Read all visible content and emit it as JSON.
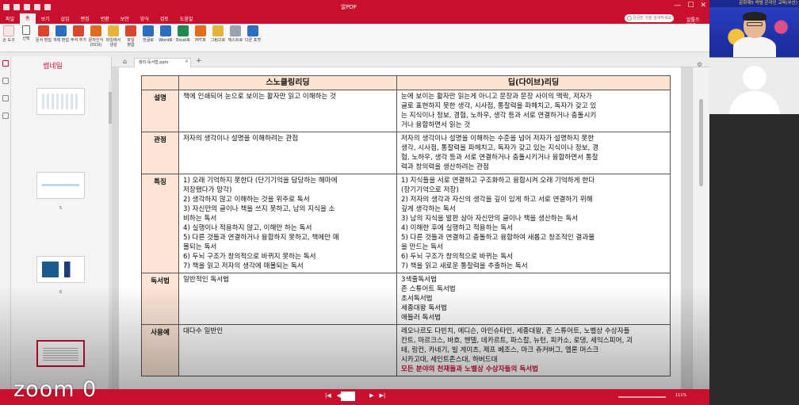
{
  "window": {
    "app_title": "알PDF",
    "controls": [
      "—",
      "☐",
      "✕"
    ]
  },
  "menu": {
    "items": [
      "파일",
      "홈",
      "보기",
      "삽입",
      "편집",
      "변환",
      "보안",
      "양식",
      "검토",
      "도움말"
    ],
    "active_index": 1,
    "search_placeholder": "궁금한 것을 검색하세요!",
    "right_title": "알툴즈 PDF"
  },
  "toolbar": {
    "tools": [
      {
        "label": "손 도구",
        "label2": "",
        "icon": "hand-icon",
        "color": ""
      },
      {
        "label": "선택",
        "label2": "",
        "icon": "cursor-icon",
        "color": ""
      },
      {
        "label": "문서 편집",
        "label2": "",
        "icon": "text-edit-icon",
        "color": "red"
      },
      {
        "label": "개체 편집",
        "label2": "",
        "icon": "object-edit-icon",
        "color": "blue"
      },
      {
        "label": "주석 추가",
        "label2": "",
        "icon": "comment-icon",
        "color": "red"
      },
      {
        "label": "문자인식",
        "label2": "(OCR)",
        "icon": "ocr-icon",
        "color": "orange"
      },
      {
        "label": "파일에서",
        "label2": "생성",
        "icon": "create-file-icon",
        "color": "yellow"
      },
      {
        "label": "파일",
        "label2": "병합",
        "icon": "merge-icon",
        "color": "red"
      },
      {
        "label": "한글로",
        "label2": "",
        "icon": "hwp-icon",
        "color": "blue"
      },
      {
        "label": "Word로",
        "label2": "",
        "icon": "word-icon",
        "color": "blue"
      },
      {
        "label": "Excel로",
        "label2": "",
        "icon": "excel-icon",
        "color": "green"
      },
      {
        "label": "PPT로",
        "label2": "",
        "icon": "ppt-icon",
        "color": "orange"
      },
      {
        "label": "그림으로",
        "label2": "",
        "icon": "image-icon",
        "color": "yellow"
      },
      {
        "label": "텍스트로",
        "label2": "",
        "icon": "text-icon",
        "color": "gray"
      },
      {
        "label": "다른 포맷",
        "label2": "",
        "icon": "format-icon",
        "color": "blue"
      }
    ]
  },
  "thumbnails": {
    "title": "썸네일",
    "pages": [
      "",
      "5",
      "6",
      ""
    ]
  },
  "tabs": {
    "home_icon": "⌂",
    "tab_label": "정리:독서법.pptx",
    "close": "×",
    "add": "+"
  },
  "table": {
    "headers": [
      "",
      "스노클링리딩",
      "딥(다이브)리딩"
    ],
    "rows": [
      {
        "head": "설명",
        "col1": [
          "책에 인쇄되어 눈으로 보이는 활자만 읽고 이해하는 것"
        ],
        "col2": [
          "눈에 보이는 활자만 읽는게 아니고 문장과 문장 사이의 맥락, 저자가",
          "글로 표현하지 못한 생각, 시사점, 통찰력을 파헤치고, 독자가 갖고 있",
          "는 지식이나 정보, 경험, 노하우, 생각 등과 서로 연결하거나 충돌시키",
          "거나 융합하면서 읽는 것"
        ]
      },
      {
        "head": "관점",
        "col1": [
          "저자의 생각이나 설명을 이해하려는 관점"
        ],
        "col2": [
          "저자의 생각이나 설명을 이해하는 수준을 넘어 저자가 설명하지 못한",
          "생각, 시사점, 통찰력을 파헤치고, 독자가 갖고 있는 지식이나 정보, 경",
          "험, 노하우, 생각 등과 서로 연결하거나 충돌시키거나 융합하면서 통찰",
          "력과 창의력을  생산하려는 관점"
        ]
      },
      {
        "head": "특징",
        "col1": [
          "1) 오래 기억하지 못한다 (단기기억을 담당하는 해마에",
          "    저장됐다가 망각)",
          "2) 생각하지 않고 이해하는 것을 위주로 독서",
          "3) 자신만의 글이나 책을 쓰지 못하고, 남의 지식을  소",
          "    비하는 독서",
          "4) 실행이나 적용하지 않고, 이해만 하는 독서",
          "5) 다른 것들과 연결하거나 융합하지 못하고, 책에만 매",
          "    몰되는 독서",
          "6) 두뇌 구조가 창의적으로 바뀌지 못하는 독서",
          "7) 책을 읽고 저자의 생각에 매몰되는 독서"
        ],
        "col2": [
          "1) 지식들을 서로 연결하고 구조화하고 융합시켜 오래 기억하게 한다",
          "(장기기억으로 저장)",
          "2) 저자의 생각과 자신의 생각을 깊이 있게 하고 서로 연결하기 위해",
          "깊게 생각하는 독서",
          "3) 남의 지식을 발판 삼아 자신만의 글이나 책을 생산하는 독서",
          "4) 이해한 후에 실행하고 적용하는 독서",
          "5) 다른 것들과 연결하고 충돌하고 융합하여 새롭고 창조적인 결과물",
          "을 만드는 독서",
          "6) 두뇌 구조가 창의적으로 바뀌는 독서",
          "7) 책을 읽고 새로운 통찰력을 추출하는 독서"
        ]
      },
      {
        "head": "독서법",
        "col1": [
          "일반적인 독서법"
        ],
        "col2": [
          "3색줄독서법",
          "존 스튜어트 독서법",
          "초서독서법",
          "세종대왕 독서법",
          "애들러 독서법"
        ]
      },
      {
        "head": "사용예",
        "col1": [
          "대다수 일반인"
        ],
        "col2": [
          "레오나르도 다빈치, 에디슨, 아인슈타인, 세종대왕, 존 스튜어트, 노벨상 수상자들",
          "칸트, 마르크스, 바흐, 헨델, 데카르트, 파스칼, 뉴턴, 피카소, 로댕, 세익스피어, 괴",
          "테, 링컨, 카네기, 빌 게이츠, 제프 베조스, 마크 쥬커버그, 엘론 머스크",
          "시카고대, 세인트존스대, 하버드대"
        ],
        "col2_emphasis": "모든 분야의 천재들과 노벨상 수상자들의 독서법"
      }
    ]
  },
  "status": {
    "nav": [
      "|◀",
      "◀"
    ],
    "nav_next": [
      "▶",
      "▶|"
    ],
    "page": "",
    "zoom": "111%"
  },
  "overlay": {
    "zoom_label": "zoom  0"
  },
  "video": {
    "banner": "문화재5 박범  온라인 교육(부산)"
  }
}
